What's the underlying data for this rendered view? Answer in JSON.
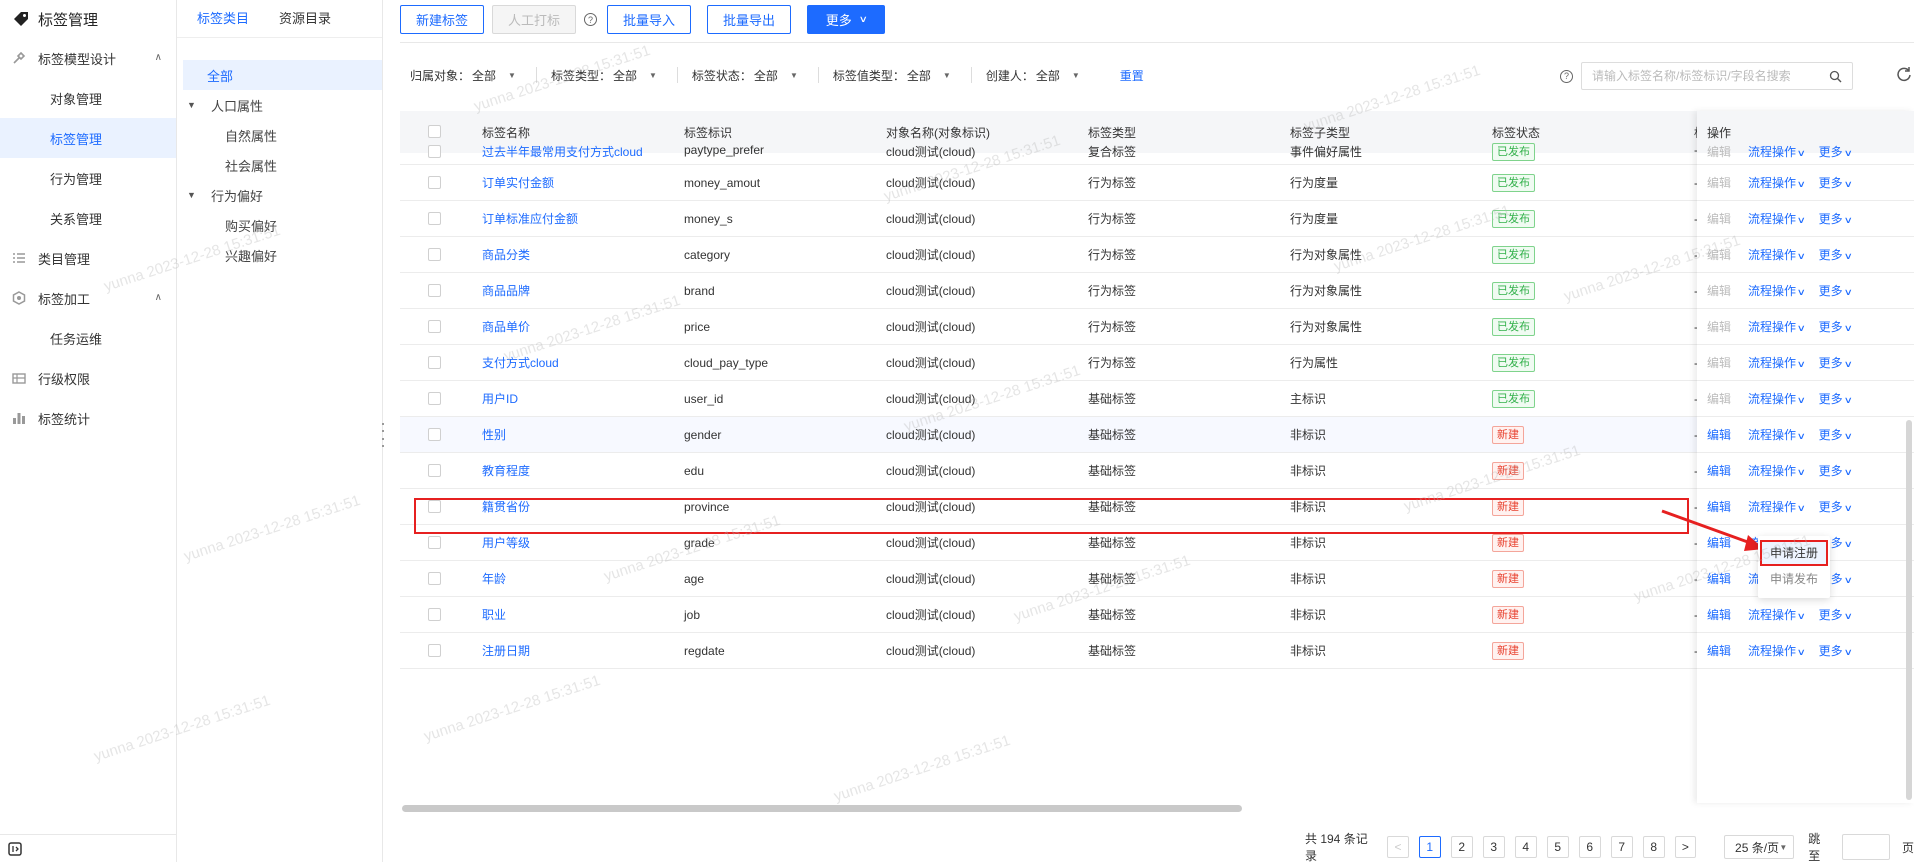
{
  "app": {
    "title": "标签管理"
  },
  "sidebar": {
    "items": [
      {
        "label": "标签模型设计",
        "icon": "tools-icon",
        "expanded": true,
        "children": [
          "对象管理",
          "标签管理",
          "行为管理",
          "关系管理"
        ],
        "active_child": "标签管理"
      },
      {
        "label": "类目管理",
        "icon": "list-icon"
      },
      {
        "label": "标签加工",
        "icon": "hexagon-icon",
        "expanded": true,
        "children": [
          "任务运维"
        ]
      },
      {
        "label": "行级权限",
        "icon": "lock-grid-icon"
      },
      {
        "label": "标签统计",
        "icon": "bar-chart-icon"
      }
    ]
  },
  "category_panel": {
    "tabs": [
      "标签类目",
      "资源目录"
    ],
    "active_tab": "标签类目",
    "tree": {
      "all": "全部",
      "groups": [
        {
          "label": "人口属性",
          "children": [
            "自然属性",
            "社会属性"
          ]
        },
        {
          "label": "行为偏好",
          "children": [
            "购买偏好",
            "兴趣偏好"
          ]
        }
      ]
    }
  },
  "toolbar": {
    "new_tag": "新建标签",
    "manual_tag": "人工打标",
    "batch_import": "批量导入",
    "batch_export": "批量导出",
    "more": "更多"
  },
  "filters": [
    {
      "label": "归属对象：",
      "value": "全部"
    },
    {
      "label": "标签类型：",
      "value": "全部"
    },
    {
      "label": "标签状态：",
      "value": "全部"
    },
    {
      "label": "标签值类型：",
      "value": "全部"
    },
    {
      "label": "创建人：",
      "value": "全部"
    }
  ],
  "reset_label": "重置",
  "search": {
    "placeholder": "请输入标签名称/标签标识/字段名搜索"
  },
  "table": {
    "columns": [
      "标签名称",
      "标签标识",
      "对象名称(对象标识)",
      "标签类型",
      "标签子类型",
      "标签状态",
      "标",
      "操作"
    ],
    "rows": [
      {
        "name": "过去半年最常用支付方式cloud",
        "id": "paytype_prefer",
        "object": "cloud测试(cloud)",
        "type": "复合标签",
        "subtype": "事件偏好属性",
        "status": "已发布",
        "extra": "-"
      },
      {
        "name": "订单实付金额",
        "id": "money_amout",
        "object": "cloud测试(cloud)",
        "type": "行为标签",
        "subtype": "行为度量",
        "status": "已发布",
        "extra": "-"
      },
      {
        "name": "订单标准应付金额",
        "id": "money_s",
        "object": "cloud测试(cloud)",
        "type": "行为标签",
        "subtype": "行为度量",
        "status": "已发布",
        "extra": "-"
      },
      {
        "name": "商品分类",
        "id": "category",
        "object": "cloud测试(cloud)",
        "type": "行为标签",
        "subtype": "行为对象属性",
        "status": "已发布",
        "extra": "-"
      },
      {
        "name": "商品品牌",
        "id": "brand",
        "object": "cloud测试(cloud)",
        "type": "行为标签",
        "subtype": "行为对象属性",
        "status": "已发布",
        "extra": "-"
      },
      {
        "name": "商品单价",
        "id": "price",
        "object": "cloud测试(cloud)",
        "type": "行为标签",
        "subtype": "行为对象属性",
        "status": "已发布",
        "extra": "-"
      },
      {
        "name": "支付方式cloud",
        "id": "cloud_pay_type",
        "object": "cloud测试(cloud)",
        "type": "行为标签",
        "subtype": "行为属性",
        "status": "已发布",
        "extra": "-"
      },
      {
        "name": "用户ID",
        "id": "user_id",
        "object": "cloud测试(cloud)",
        "type": "基础标签",
        "subtype": "主标识",
        "status": "已发布",
        "extra": "-"
      },
      {
        "name": "性别",
        "id": "gender",
        "object": "cloud测试(cloud)",
        "type": "基础标签",
        "subtype": "非标识",
        "status": "新建",
        "extra": "-"
      },
      {
        "name": "教育程度",
        "id": "edu",
        "object": "cloud测试(cloud)",
        "type": "基础标签",
        "subtype": "非标识",
        "status": "新建",
        "extra": "-"
      },
      {
        "name": "籍贯省份",
        "id": "province",
        "object": "cloud测试(cloud)",
        "type": "基础标签",
        "subtype": "非标识",
        "status": "新建",
        "extra": "-"
      },
      {
        "name": "用户等级",
        "id": "grade",
        "object": "cloud测试(cloud)",
        "type": "基础标签",
        "subtype": "非标识",
        "status": "新建",
        "extra": "-"
      },
      {
        "name": "年龄",
        "id": "age",
        "object": "cloud测试(cloud)",
        "type": "基础标签",
        "subtype": "非标识",
        "status": "新建",
        "extra": "-"
      },
      {
        "name": "职业",
        "id": "job",
        "object": "cloud测试(cloud)",
        "type": "基础标签",
        "subtype": "非标识",
        "status": "新建",
        "extra": "-"
      },
      {
        "name": "注册日期",
        "id": "regdate",
        "object": "cloud测试(cloud)",
        "type": "基础标签",
        "subtype": "非标识",
        "status": "新建",
        "extra": "-"
      }
    ],
    "actions": {
      "edit": "编辑",
      "flow": "流程操作",
      "more": "更多"
    }
  },
  "flow_menu": {
    "items": [
      "申请注册",
      "申请发布"
    ],
    "highlighted": "申请注册"
  },
  "pagination": {
    "total_text": "共 194 条记录",
    "pages": [
      "1",
      "2",
      "3",
      "4",
      "5",
      "6",
      "7",
      "8"
    ],
    "current": "1",
    "page_size": "25 条/页",
    "jump_label": "跳至",
    "page_unit": "页"
  },
  "watermark_text": "yunna 2023-12-28 15:31:51",
  "colors": {
    "primary": "#1d6bff",
    "published": "#33b14b",
    "new": "#e8412f",
    "highlight": "#e62020"
  }
}
